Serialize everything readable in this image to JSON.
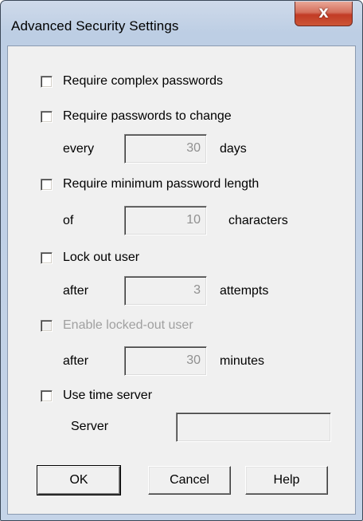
{
  "window": {
    "title": "Advanced Security Settings",
    "close_glyph": "X"
  },
  "options": {
    "complex_passwords": {
      "label": "Require complex passwords",
      "checked": false
    },
    "password_change": {
      "label": "Require passwords to change",
      "checked": false,
      "prefix": "every",
      "value": "30",
      "suffix": "days"
    },
    "min_length": {
      "label": "Require minimum password length",
      "checked": false,
      "prefix": "of",
      "value": "10",
      "suffix": "characters"
    },
    "lockout": {
      "label": "Lock out user",
      "checked": false,
      "prefix": "after",
      "value": "3",
      "suffix": "attempts"
    },
    "enable_locked": {
      "label": "Enable locked-out user",
      "checked": false,
      "disabled": true,
      "prefix": "after",
      "value": "30",
      "suffix": "minutes"
    },
    "time_server": {
      "label": "Use time server",
      "checked": false,
      "server_label": "Server",
      "server_value": ""
    }
  },
  "buttons": {
    "ok": "OK",
    "cancel": "Cancel",
    "help": "Help"
  },
  "colors": {
    "frame": "#bdcee4",
    "client": "#f0f0f0",
    "close_button": "#c23b25",
    "disabled_text": "#a0a0a0"
  },
  "icons": {
    "close": "close-icon"
  }
}
